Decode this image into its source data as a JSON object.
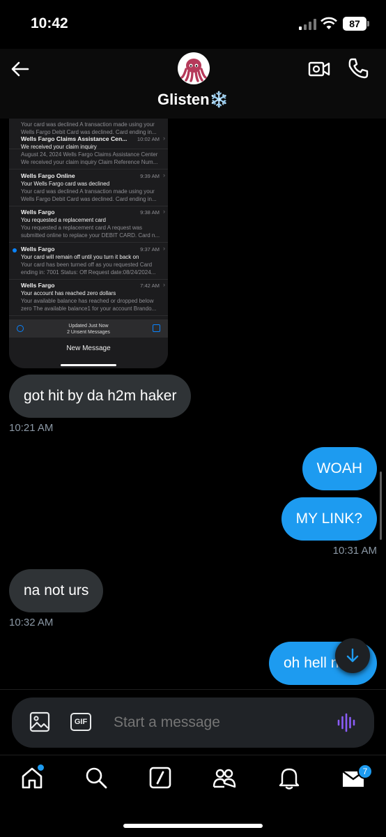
{
  "status_bar": {
    "time": "10:42",
    "battery": "87"
  },
  "header": {
    "contact_name": "Glisten",
    "contact_emoji": "❄️"
  },
  "shared_screenshot": {
    "top_preview_1": "Your card was declined A transaction made using your",
    "top_preview_2": "Wells Fargo Debit Card was declined. Card ending in...",
    "emails": [
      {
        "sender": "Wells Fargo Claims Assistance Cen...",
        "time": "10:02 AM",
        "subject": "We received your claim inquiry",
        "preview1": "August 24, 2024 Wells Fargo Claims Assistance Center",
        "preview2": "We received your claim inquiry Claim Reference Num...",
        "unread": false
      },
      {
        "sender": "Wells Fargo Online",
        "time": "9:39 AM",
        "subject": "Your Wells Fargo card was declined",
        "preview1": "Your card was declined A transaction made using your",
        "preview2": "Wells Fargo Debit Card was declined. Card ending in...",
        "unread": false
      },
      {
        "sender": "Wells Fargo",
        "time": "9:38 AM",
        "subject": "You requested a replacement card",
        "preview1": "You requested a replacement card A request was",
        "preview2": "submitted online to replace your DEBIT CARD. Card n...",
        "unread": false
      },
      {
        "sender": "Wells Fargo",
        "time": "9:37 AM",
        "subject": "Your card will remain off until you turn it back on",
        "preview1": "Your card has been turned off as you requested Card",
        "preview2": "ending in: 7001 Status: Off Request date:08/24/2024...",
        "unread": true
      },
      {
        "sender": "Wells Fargo",
        "time": "7:42 AM",
        "subject": "Your account has reached zero dollars",
        "preview1": "Your available balance has reached or dropped below",
        "preview2": "zero The available balance1 for your account Brando...",
        "unread": false
      }
    ],
    "toolbar_line1": "Updated Just Now",
    "toolbar_line2": "2 Unsent Messages",
    "new_message_label": "New Message"
  },
  "messages": [
    {
      "direction": "in",
      "text": "got hit by da h2m haker"
    },
    {
      "direction": "out",
      "text": "WOAH"
    },
    {
      "direction": "out",
      "text": "MY LINK?"
    },
    {
      "direction": "in",
      "text": "na not urs"
    },
    {
      "direction": "out",
      "text": "oh hell n"
    }
  ],
  "timestamps": [
    "10:21 AM",
    "10:31 AM",
    "10:32 AM"
  ],
  "composer": {
    "placeholder": "Start a message",
    "gif_label": "GIF"
  },
  "tabbar": {
    "messages_badge": "7"
  },
  "colors": {
    "accent": "#1d9bf0",
    "incoming_bubble": "#2f3336",
    "voice_icon": "#8a5cf6"
  }
}
